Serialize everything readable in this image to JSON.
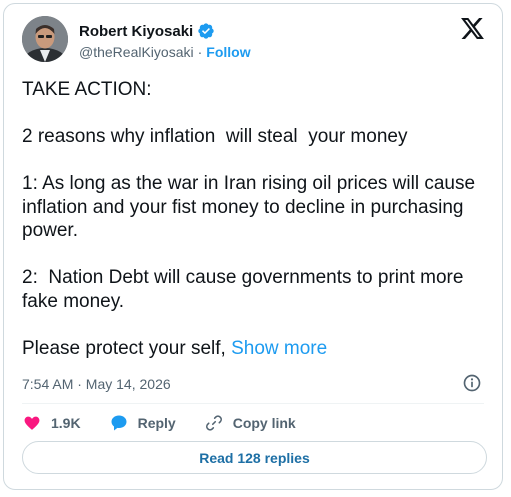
{
  "author": {
    "name": "Robert Kiyosaki",
    "handle": "@theRealKiyosaki",
    "separator": "·",
    "follow_label": "Follow"
  },
  "tweet": {
    "text": "TAKE ACTION:\n\n2 reasons why inflation  will steal  your money\n\n1: As long as the war in Iran rising oil prices will cause inflation and your fist money to decline in purchasing power.\n\n2:  Nation Debt will cause governments to print more fake money.\n\nPlease protect your self,",
    "show_more_label": "Show more",
    "timestamp": "7:54 AM · May 14, 2026"
  },
  "actions": {
    "likes_count": "1.9K",
    "reply_label": "Reply",
    "copy_link_label": "Copy link"
  },
  "read_replies_label": "Read 128 replies",
  "icons": {
    "verified": "verified-badge-icon",
    "logo": "x-logo-icon",
    "info": "info-icon",
    "like": "heart-icon",
    "reply": "speech-bubble-icon",
    "copy_link": "link-icon"
  },
  "colors": {
    "accent": "#1d9bf0",
    "like": "#f91880",
    "text_secondary": "#536471"
  }
}
